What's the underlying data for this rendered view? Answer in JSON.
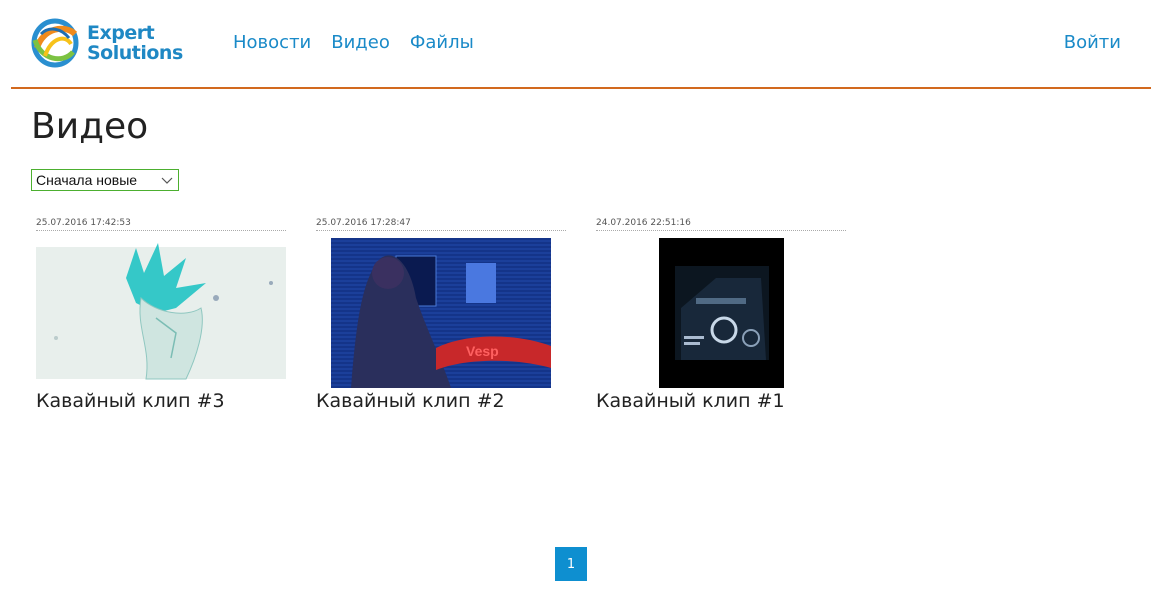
{
  "header": {
    "logo_line1": "Expert",
    "logo_line2": "Solutions",
    "nav": [
      {
        "label": "Новости"
      },
      {
        "label": "Видео"
      },
      {
        "label": "Файлы"
      }
    ],
    "login_label": "Войти",
    "accent_color": "#d2691e",
    "link_color": "#1a8ac8"
  },
  "main": {
    "title": "Видео",
    "sort": {
      "selected": "Сначала новые"
    },
    "videos": [
      {
        "date": "25.07.2016 17:42:53",
        "title": "Кавайный клип #3",
        "thumbnail": "anime-frame-cyan-hair"
      },
      {
        "date": "25.07.2016 17:28:47",
        "title": "Кавайный клип #2",
        "thumbnail": "dark-blue-stage-frame"
      },
      {
        "date": "24.07.2016 22:51:16",
        "title": "Кавайный клип #1",
        "thumbnail": "dark-motorcycle-frame"
      }
    ]
  },
  "pagination": {
    "current_page": "1",
    "active_color": "#0e8fd0"
  }
}
